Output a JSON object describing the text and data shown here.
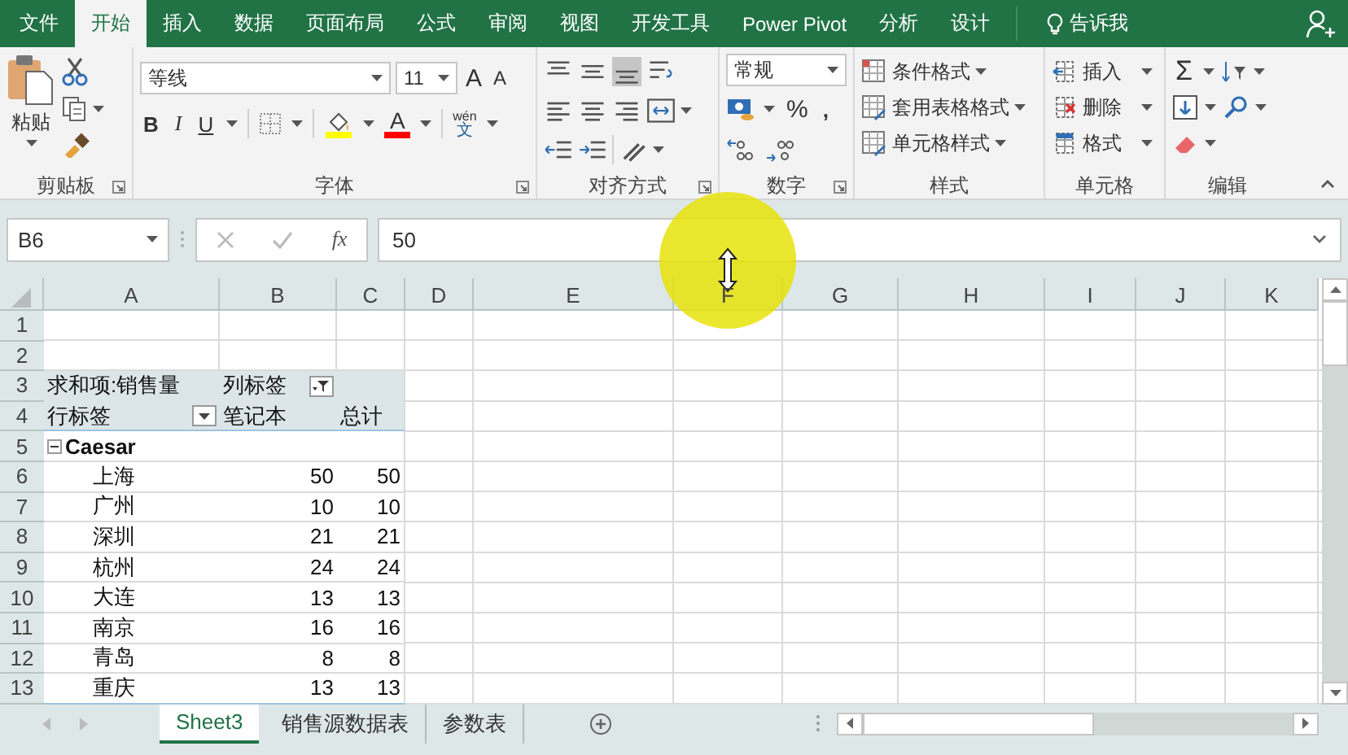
{
  "menu_tabs": [
    {
      "label": "文件",
      "selected": false
    },
    {
      "label": "开始",
      "selected": true
    },
    {
      "label": "插入",
      "selected": false
    },
    {
      "label": "数据",
      "selected": false
    },
    {
      "label": "页面布局",
      "selected": false
    },
    {
      "label": "公式",
      "selected": false
    },
    {
      "label": "审阅",
      "selected": false
    },
    {
      "label": "视图",
      "selected": false
    },
    {
      "label": "开发工具",
      "selected": false
    },
    {
      "label": "Power Pivot",
      "selected": false
    },
    {
      "label": "分析",
      "selected": false
    },
    {
      "label": "设计",
      "selected": false
    }
  ],
  "tell_me": "告诉我",
  "ribbon": {
    "clipboard": {
      "label": "剪贴板",
      "paste": "粘贴"
    },
    "font": {
      "label": "字体",
      "font_name": "等线",
      "font_size": "11",
      "grow": "A",
      "shrink": "A",
      "bold": "B",
      "italic": "I",
      "underline": "U",
      "font_color": "A",
      "phonetic_top": "wén",
      "phonetic_bottom": "文"
    },
    "alignment": {
      "label": "对齐方式",
      "vertical": [
        {
          "kind": "top",
          "selected": false
        },
        {
          "kind": "middle",
          "selected": false
        },
        {
          "kind": "bottom",
          "selected": true
        }
      ]
    },
    "number": {
      "label": "数字",
      "format": "常规",
      "percent": "%",
      "comma": ","
    },
    "styles": {
      "label": "样式",
      "items": [
        "条件格式",
        "套用表格格式",
        "单元格样式"
      ]
    },
    "cells": {
      "label": "单元格",
      "items": [
        "插入",
        "删除",
        "格式"
      ]
    },
    "editing": {
      "label": "编辑",
      "sum": "Σ"
    }
  },
  "formula_bar": {
    "name_box": "B6",
    "fx": "fx",
    "value": "50"
  },
  "sheet": {
    "columns": [
      "A",
      "B",
      "C",
      "D",
      "E",
      "F",
      "G",
      "H",
      "I",
      "J",
      "K"
    ],
    "rows": [
      "1",
      "2",
      "3",
      "4",
      "5",
      "6",
      "7",
      "8",
      "9",
      "10",
      "11",
      "12",
      "13"
    ]
  },
  "pivot": {
    "value_field": "求和项:销售量",
    "column_label": "列标签",
    "row_label": "行标签",
    "column_item": "笔记本",
    "total": "总计",
    "group": {
      "name": "Caesar",
      "expanded": true,
      "rows": [
        {
          "label": "上海",
          "value": "50",
          "total": "50"
        },
        {
          "label": "广州",
          "value": "10",
          "total": "10"
        },
        {
          "label": "深圳",
          "value": "21",
          "total": "21"
        },
        {
          "label": "杭州",
          "value": "24",
          "total": "24"
        },
        {
          "label": "大连",
          "value": "13",
          "total": "13"
        },
        {
          "label": "南京",
          "value": "16",
          "total": "16"
        },
        {
          "label": "青岛",
          "value": "8",
          "total": "8"
        },
        {
          "label": "重庆",
          "value": "13",
          "total": "13"
        }
      ]
    }
  },
  "sheet_tabs": [
    {
      "label": "Sheet3",
      "selected": true
    },
    {
      "label": "销售源数据表",
      "selected": false
    },
    {
      "label": "参数表",
      "selected": false
    }
  ]
}
